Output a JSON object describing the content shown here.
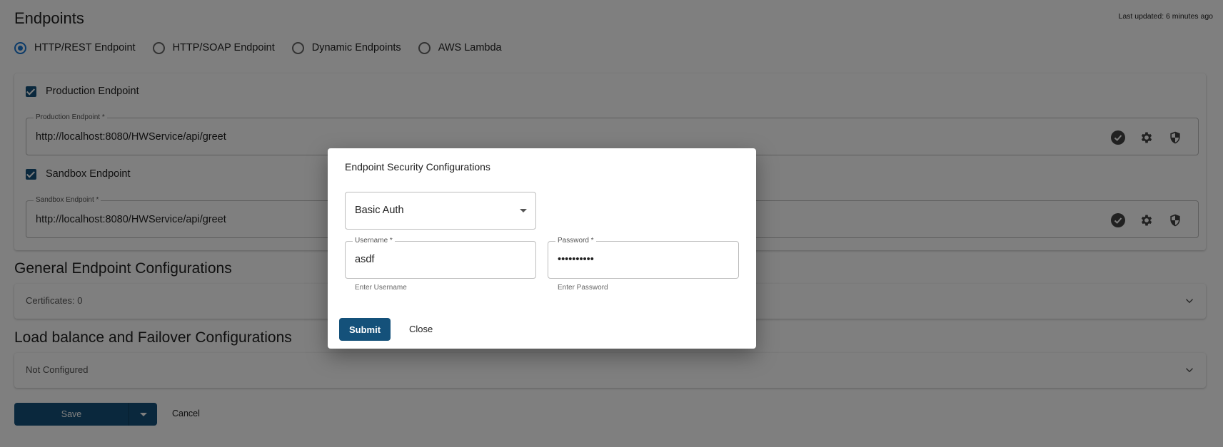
{
  "page": {
    "title": "Endpoints",
    "last_updated": "Last updated: 6 minutes ago"
  },
  "endpoint_types": [
    {
      "label": "HTTP/REST Endpoint",
      "checked": true
    },
    {
      "label": "HTTP/SOAP Endpoint",
      "checked": false
    },
    {
      "label": "Dynamic Endpoints",
      "checked": false
    },
    {
      "label": "AWS Lambda",
      "checked": false
    }
  ],
  "production": {
    "checkbox_label": "Production Endpoint",
    "field_label": "Production Endpoint *",
    "value": "http://localhost:8080/HWService/api/greet"
  },
  "sandbox": {
    "checkbox_label": "Sandbox Endpoint",
    "field_label": "Sandbox Endpoint *",
    "value": "http://localhost:8080/HWService/api/greet"
  },
  "general": {
    "title": "General Endpoint Configurations",
    "summary": "Certificates: 0"
  },
  "loadbalance": {
    "title": "Load balance and Failover Configurations",
    "summary": "Not Configured"
  },
  "actions": {
    "save_label": "Save",
    "cancel_label": "Cancel"
  },
  "dialog": {
    "title": "Endpoint Security Configurations",
    "auth_type": "Basic Auth",
    "username_label": "Username *",
    "username_value": "asdf",
    "username_helper": "Enter Username",
    "password_label": "Password *",
    "password_value": "••••••••••",
    "password_helper": "Enter Password",
    "submit_label": "Submit",
    "close_label": "Close"
  },
  "colors": {
    "primary": "#14517a",
    "radio_accent": "#1976d2",
    "overlay": "rgba(0,0,0,0.5)"
  }
}
